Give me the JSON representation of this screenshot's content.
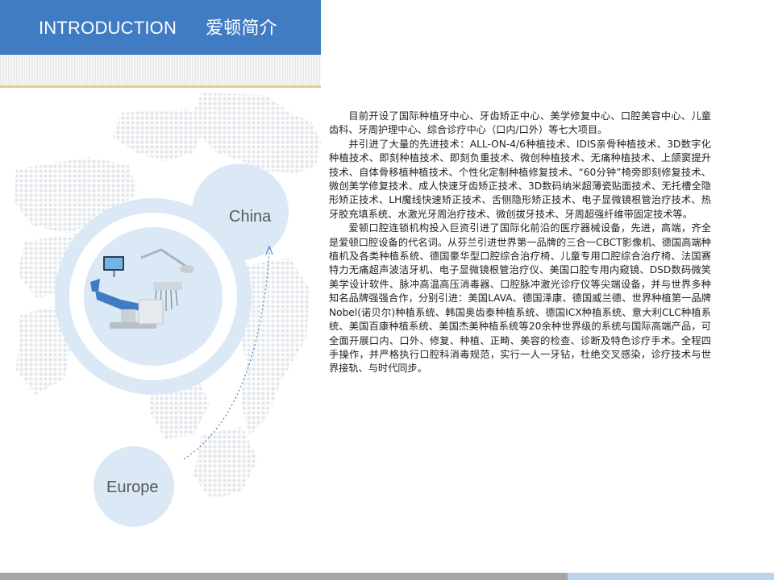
{
  "header": {
    "title_en": "INTRODUCTION",
    "title_cn": "爱顿简介"
  },
  "map": {
    "labels": {
      "china": "China",
      "europe": "Europe"
    }
  },
  "content": {
    "paragraphs": [
      "目前开设了国际种植牙中心、牙齿矫正中心、美学修复中心、口腔美容中心、儿童齿科、牙周护理中心、综合诊疗中心（口内/口外）等七大项目。",
      "并引进了大量的先进技术：ALL-ON-4/6种植技术、IDIS亲骨种植技术、3D数字化种植技术、即刻种植技术、即刻负重技术、微创种植技术、无痛种植技术、上颌窦提升技术、自体骨移植种植技术、个性化定制种植修复技术、“60分钟”椅旁即刻修复技术、微创美学修复技术、成人快速牙齿矫正技术、3D数码纳米超薄瓷贴面技术、无托槽全隐形矫正技术、LH魔线快速矫正技术、舌侧隐形矫正技术、电子显微镜根管治疗技术、热牙胶充填系统、水激光牙周治疗技术、微创拔牙技术、牙周超强纤维带固定技术等。",
      "爱顿口腔连锁机构投入巨资引进了国际化前沿的医疗器械设备，先进，高端，齐全是爱顿口腔设备的代名词。从芬兰引进世界第一品牌的三合一CBCT影像机、德国高端种植机及各类种植系统、德国豪华型口腔综合治疗椅、儿童专用口腔综合治疗椅、法国赛特力无痛超声波洁牙机、电子显微镜根管治疗仪、美国口腔专用内窥镜、DSD数码微笑美学设计软件、脉冲高温高压消毒器、口腔脉冲激光诊疗仪等尖端设备，并与世界多种知名品牌强强合作，分别引进：美国LAVA、德国泽康、德国威兰德、世界种植第一品牌Nobel(诺贝尔)种植系统、韩国奥齿泰种植系统、德国ICX种植系统、意大利CLC种植系统、美国百康种植系统、美国杰美种植系统等20余种世界级的系统与国际高端产品，可全面开展口内、口外、修复、种植、正畸、美容的检查、诊断及特色诊疗手术。全程四手操作，并严格执行口腔科消毒规范，实行一人一牙钻，杜绝交叉感染，诊疗技术与世界接轨、与时代同步。"
    ]
  }
}
